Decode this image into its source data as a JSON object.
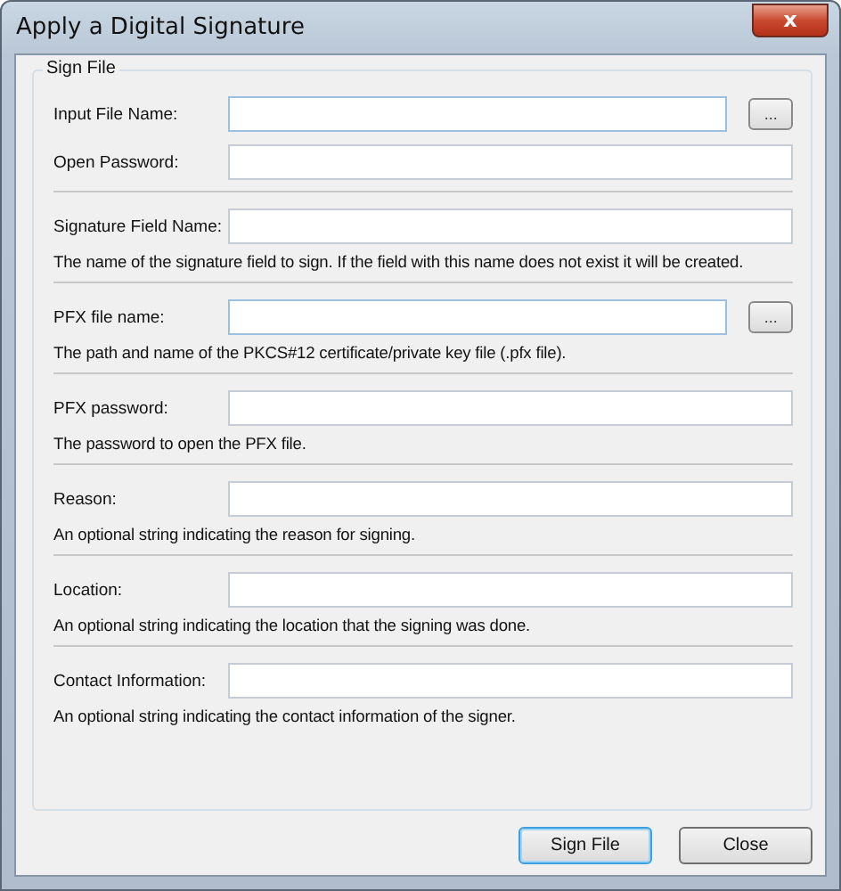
{
  "window": {
    "title": "Apply a Digital Signature",
    "close_glyph": "x"
  },
  "group": {
    "title": "Sign File"
  },
  "sections": [
    {
      "rows": [
        {
          "label": "Input File Name:",
          "browse": true,
          "browse_label": "..."
        },
        {
          "label": "Open Password:",
          "browse": false
        }
      ]
    },
    {
      "rows": [
        {
          "label": "Signature Field Name:",
          "browse": false
        }
      ],
      "description": "The name of the signature field to sign. If the field with this name does not exist it will be created."
    },
    {
      "rows": [
        {
          "label": "PFX file name:",
          "browse": true,
          "browse_label": "..."
        }
      ],
      "description": "The path and name of the PKCS#12 certificate/private key file (.pfx file)."
    },
    {
      "rows": [
        {
          "label": "PFX password:",
          "browse": false
        }
      ],
      "description": "The password to open the PFX file."
    },
    {
      "rows": [
        {
          "label": "Reason:",
          "browse": false
        }
      ],
      "description": "An optional string indicating the reason for signing."
    },
    {
      "rows": [
        {
          "label": "Location:",
          "browse": false
        }
      ],
      "description": "An optional string indicating the location that the signing was done."
    },
    {
      "rows": [
        {
          "label": "Contact Information:",
          "browse": false
        }
      ],
      "description": "An optional string indicating the contact information of the signer."
    }
  ],
  "buttons": [
    {
      "label": "Sign File",
      "default": true
    },
    {
      "label": "Close",
      "default": false
    }
  ]
}
